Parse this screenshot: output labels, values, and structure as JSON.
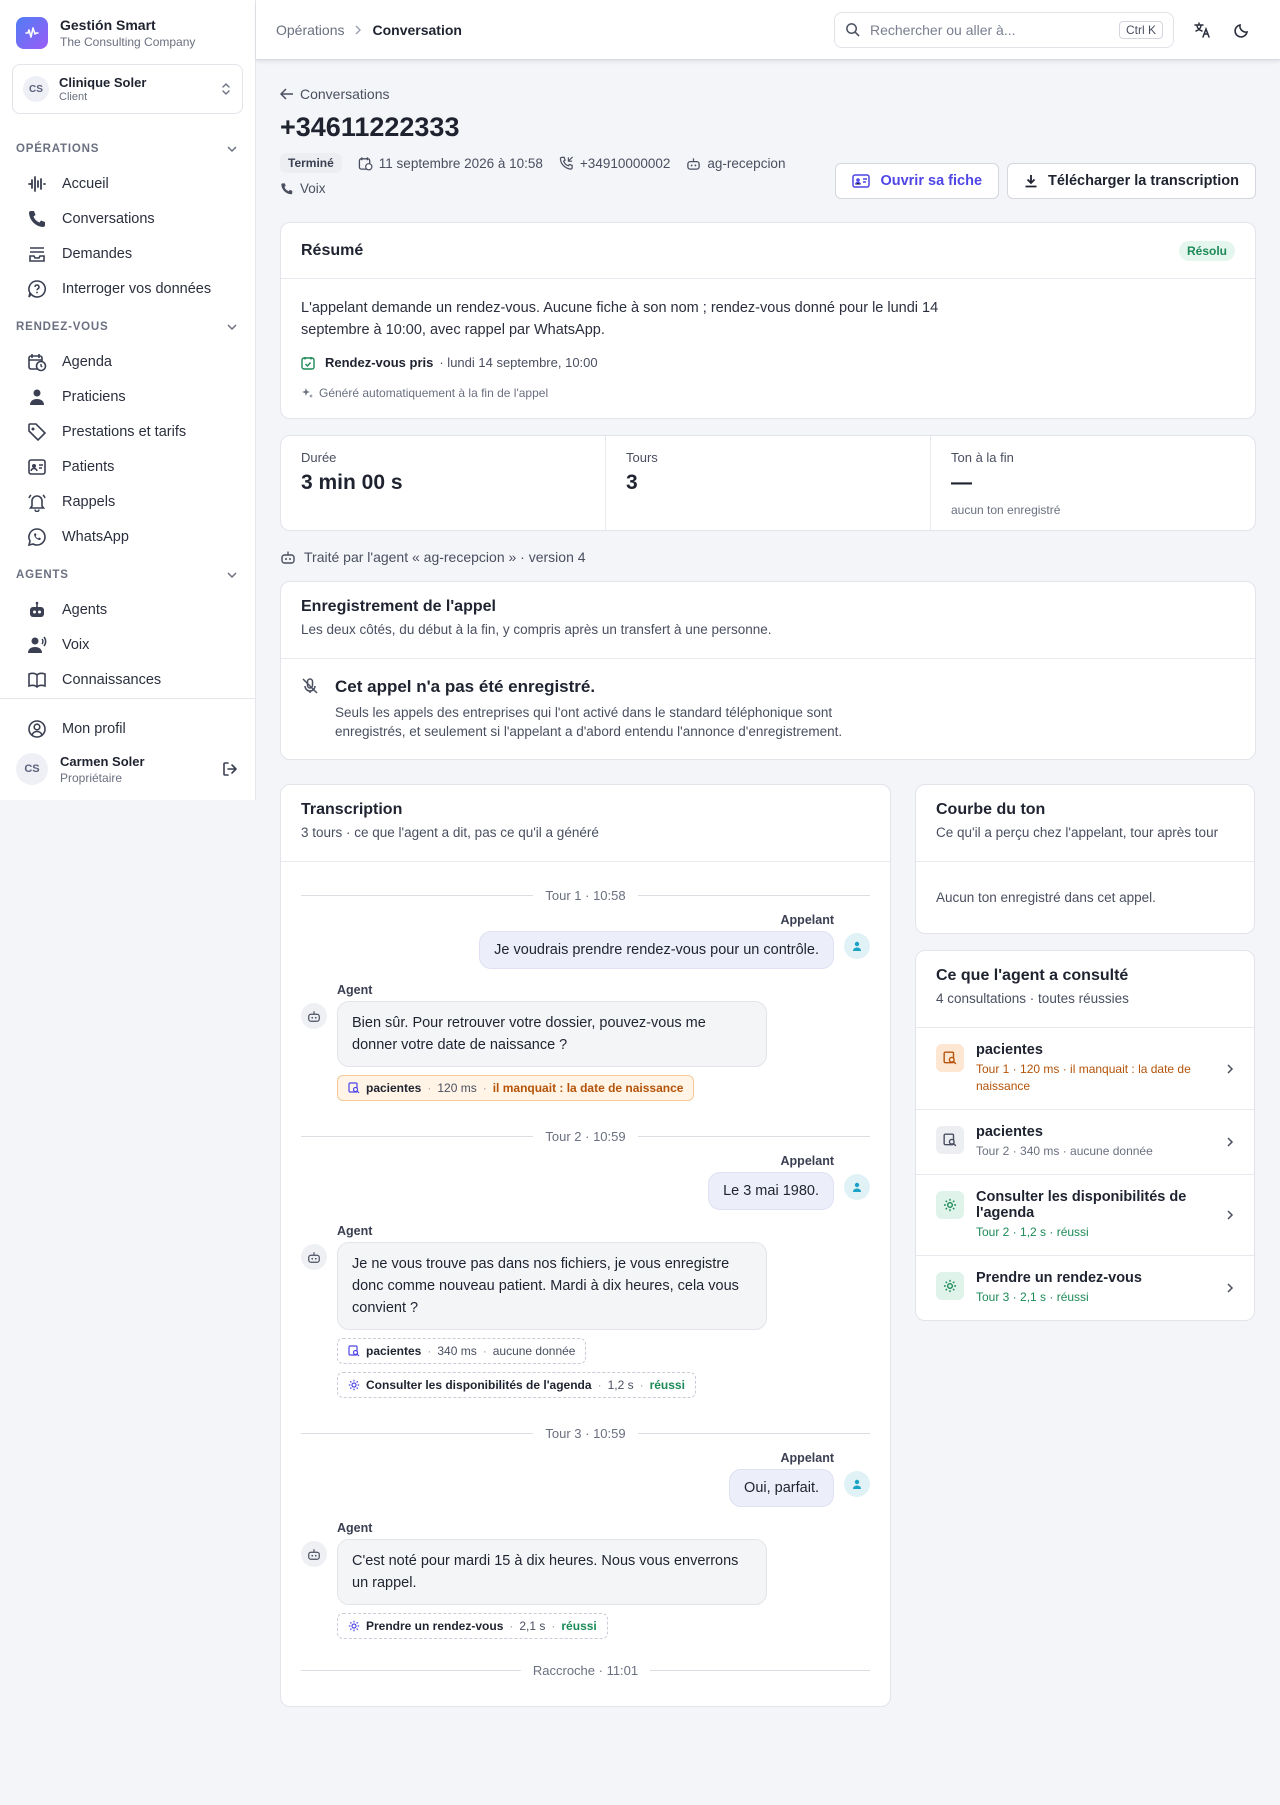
{
  "brand": {
    "name": "Gestión Smart",
    "company": "The Consulting Company"
  },
  "tenant": {
    "initials": "CS",
    "name": "Clinique Soler",
    "role": "Client"
  },
  "nav": {
    "sections": [
      {
        "label": "OPÉRATIONS",
        "items": [
          {
            "label": "Accueil",
            "icon": "waveform-icon"
          },
          {
            "label": "Conversations",
            "icon": "phone-icon"
          },
          {
            "label": "Demandes",
            "icon": "tray-icon"
          },
          {
            "label": "Interroger vos données",
            "icon": "question-icon"
          }
        ]
      },
      {
        "label": "RENDEZ-VOUS",
        "items": [
          {
            "label": "Agenda",
            "icon": "calendar-clock-icon"
          },
          {
            "label": "Praticiens",
            "icon": "user-doctor-icon"
          },
          {
            "label": "Prestations et tarifs",
            "icon": "tag-icon"
          },
          {
            "label": "Patients",
            "icon": "id-card-icon"
          },
          {
            "label": "Rappels",
            "icon": "bell-icon"
          },
          {
            "label": "WhatsApp",
            "icon": "whatsapp-icon"
          }
        ]
      },
      {
        "label": "AGENTS",
        "items": [
          {
            "label": "Agents",
            "icon": "robot-icon"
          },
          {
            "label": "Voix",
            "icon": "voice-icon"
          },
          {
            "label": "Connaissances",
            "icon": "book-icon"
          }
        ]
      }
    ]
  },
  "footer": {
    "profile": "Mon profil",
    "user_initials": "CS",
    "user_name": "Carmen Soler",
    "user_role": "Propriétaire"
  },
  "topbar": {
    "crumb_parent": "Opérations",
    "crumb_current": "Conversation",
    "search_placeholder": "Rechercher ou aller à...",
    "shortcut": "Ctrl K"
  },
  "page": {
    "back": "Conversations",
    "title": "+34611222333",
    "status": "Terminé",
    "date": "11 septembre 2026 à 10:58",
    "to_number": "+34910000002",
    "agent": "ag-recepcion",
    "channel": "Voix",
    "btn_open": "Ouvrir sa fiche",
    "btn_download": "Télécharger la transcription"
  },
  "summary": {
    "title": "Résumé",
    "badge": "Résolu",
    "text": "L'appelant demande un rendez-vous. Aucune fiche à son nom ; rendez-vous donné pour le lundi 14 septembre à 10:00, avec rappel par WhatsApp.",
    "appt_label": "Rendez-vous pris",
    "appt_value": "· lundi 14 septembre, 10:00",
    "generated": "Généré automatiquement à la fin de l'appel"
  },
  "stats": [
    {
      "label": "Durée",
      "value": "3 min 00 s",
      "sub": ""
    },
    {
      "label": "Tours",
      "value": "3",
      "sub": ""
    },
    {
      "label": "Ton à la fin",
      "value": "—",
      "sub": "aucun ton enregistré"
    }
  ],
  "agent_line": "Traité par l'agent « ag-recepcion » · version 4",
  "recording": {
    "title": "Enregistrement de l'appel",
    "subtitle": "Les deux côtés, du début à la fin, y compris après un transfert à une personne.",
    "empty_title": "Cet appel n'a pas été enregistré.",
    "empty_text": "Seuls les appels des entreprises qui l'ont activé dans le standard téléphonique sont enregistrés, et seulement si l'appelant a d'abord entendu l'annonce d'enregistrement."
  },
  "transcript": {
    "title": "Transcription",
    "subtitle": "3 tours · ce que l'agent a dit, pas ce qu'il a généré",
    "caller_label": "Appelant",
    "agent_label": "Agent",
    "turns": [
      {
        "sep": "Tour 1 · 10:58",
        "caller": "Je voudrais prendre rendez-vous pour un contrôle.",
        "agent": "Bien sûr. Pour retrouver votre dossier, pouvez-vous me donner votre date de naissance ?",
        "tools": [
          {
            "name": "pacientes",
            "time": "120 ms",
            "result": "il manquait : la date de naissance",
            "kind": "warn"
          }
        ]
      },
      {
        "sep": "Tour 2 · 10:59",
        "caller": "Le 3 mai 1980.",
        "agent": "Je ne vous trouve pas dans nos fichiers, je vous enregistre donc comme nouveau patient. Mardi à dix heures, cela vous convient ?",
        "tools": [
          {
            "name": "pacientes",
            "time": "340 ms",
            "result": "aucune donnée",
            "kind": "neutral"
          },
          {
            "name": "Consulter les disponibilités de l'agenda",
            "time": "1,2 s",
            "result": "réussi",
            "kind": "ok"
          }
        ]
      },
      {
        "sep": "Tour 3 · 10:59",
        "caller": "Oui, parfait.",
        "agent": "C'est noté pour mardi 15 à dix heures. Nous vous enverrons un rappel.",
        "tools": [
          {
            "name": "Prendre un rendez-vous",
            "time": "2,1 s",
            "result": "réussi",
            "kind": "ok"
          }
        ]
      }
    ],
    "end": "Raccroche · 11:01"
  },
  "tone": {
    "title": "Courbe du ton",
    "subtitle": "Ce qu'il a perçu chez l'appelant, tour après tour",
    "empty": "Aucun ton enregistré dans cet appel."
  },
  "consulted": {
    "title": "Ce que l'agent a consulté",
    "subtitle": "4 consultations · toutes réussies",
    "items": [
      {
        "title": "pacientes",
        "sub": "Tour 1 · 120 ms · il manquait : la date de naissance",
        "kind": "warn"
      },
      {
        "title": "pacientes",
        "sub": "Tour 2 · 340 ms · aucune donnée",
        "kind": "neutral"
      },
      {
        "title": "Consulter les disponibilités de l'agenda",
        "sub": "Tour 2 · 1,2 s · réussi",
        "kind": "ok"
      },
      {
        "title": "Prendre un rendez-vous",
        "sub": "Tour 3 · 2,1 s · réussi",
        "kind": "ok"
      }
    ]
  },
  "colors": {
    "accent": "#4f46e5",
    "success": "#1d8a57",
    "warning": "#b45309",
    "caller_bubble": "#eceef9"
  }
}
